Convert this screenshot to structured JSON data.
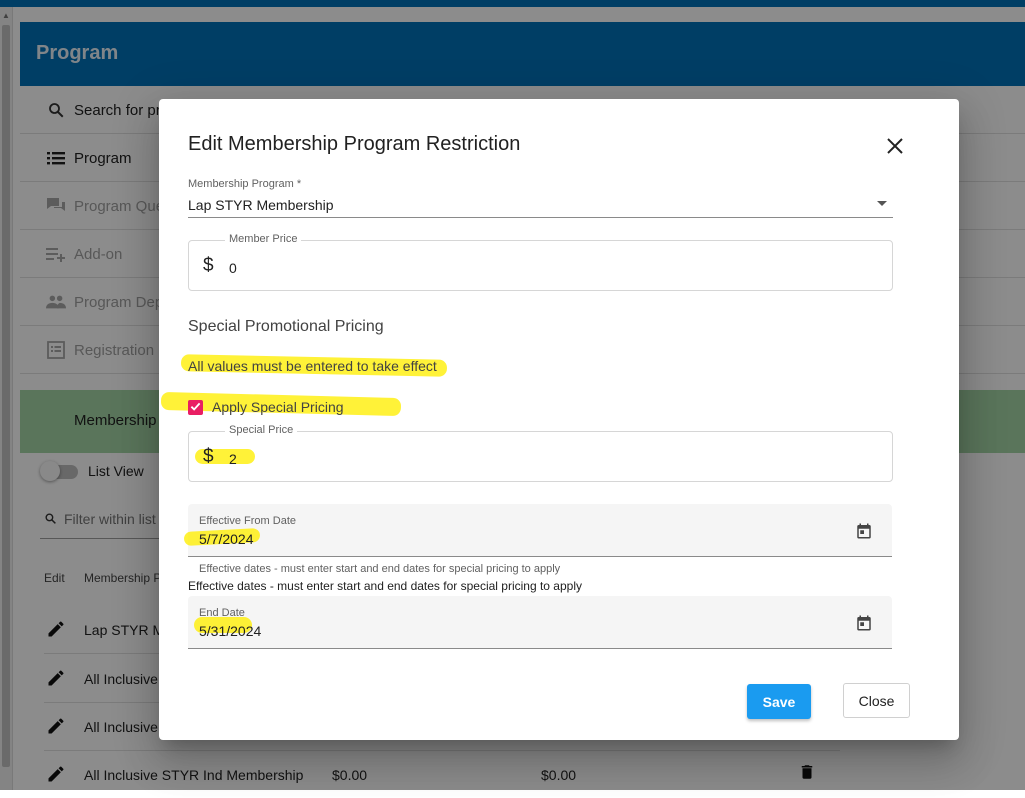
{
  "page": {
    "title": "Program",
    "sidebar": [
      {
        "label": "Search for pr",
        "icon": "search-icon"
      },
      {
        "label": "Program",
        "icon": "list-icon"
      },
      {
        "label": "Program Que",
        "icon": "question-answer-icon"
      },
      {
        "label": "Add-on",
        "icon": "playlist-add-icon"
      },
      {
        "label": "Program Dep",
        "icon": "people-icon"
      },
      {
        "label": "Registration",
        "icon": "form-icon"
      }
    ],
    "banner_label": "Membership",
    "list_view_label": "List View",
    "filter_placeholder": "Filter within list",
    "columns": {
      "edit": "Edit",
      "membership": "Membership P"
    },
    "rows": [
      {
        "name": "Lap STYR M",
        "price": "",
        "price2": ""
      },
      {
        "name": "All Inclusive",
        "price": "",
        "price2": ""
      },
      {
        "name": "All Inclusive",
        "price": "",
        "price2": ""
      },
      {
        "name": "All Inclusive STYR Ind Membership",
        "price": "$0.00",
        "price2": "$0.00"
      }
    ]
  },
  "dialog": {
    "title": "Edit Membership Program Restriction",
    "membership_program": {
      "label": "Membership Program *",
      "value": "Lap STYR Membership"
    },
    "member_price": {
      "label": "Member Price",
      "currency": "$",
      "value": "0"
    },
    "section_title": "Special Promotional Pricing",
    "note": "All values must be entered to take effect",
    "apply_special": {
      "label": "Apply Special Pricing",
      "checked": true
    },
    "special_price": {
      "label": "Special Price",
      "currency": "$",
      "value": "2"
    },
    "effective_from": {
      "label": "Effective From Date",
      "value": "5/7/2024"
    },
    "helper_text": "Effective dates - must enter start and end dates for special pricing to apply",
    "helper_text_dup": "Effective dates - must enter start and end dates for special pricing to apply",
    "end_date": {
      "label": "End Date",
      "value": "5/31/2024"
    },
    "save_label": "Save",
    "close_label": "Close"
  },
  "colors": {
    "header_blue": "#0071b9",
    "banner_green": "#a5d6a7",
    "save_blue": "#1a9bf0",
    "checkbox_pink": "#e91e63",
    "highlighter_yellow": "#ffee00"
  }
}
